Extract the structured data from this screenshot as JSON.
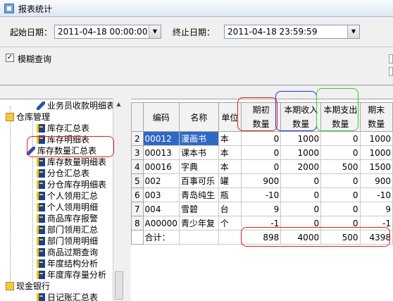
{
  "window": {
    "title": "报表统计"
  },
  "filters": {
    "start_label": "起始日期：",
    "start_value": "2011-04-18 00:00:00",
    "end_label": "终止日期：",
    "end_value": "2011-04-18 23:59:59",
    "fuzzy_label": "模糊查询",
    "fuzzy_checked": "✓"
  },
  "tree": {
    "nodes": [
      {
        "label": "业务员收款明细表",
        "icon": "pencil-book-icon"
      },
      {
        "label": "仓库管理",
        "icon": "folder-icon"
      },
      {
        "label": "库存汇总表",
        "icon": "book-icon"
      },
      {
        "label": "库存明细表",
        "icon": "book-icon"
      },
      {
        "label": "库存数量汇总表",
        "icon": "pencil-book-icon"
      },
      {
        "label": "库存数量明细表",
        "icon": "book-icon"
      },
      {
        "label": "分仓汇总表",
        "icon": "book-icon"
      },
      {
        "label": "分仓库存明细表",
        "icon": "book-icon"
      },
      {
        "label": "个人领用汇总",
        "icon": "book-icon"
      },
      {
        "label": "个人领用明细",
        "icon": "book-icon"
      },
      {
        "label": "商品库存报警",
        "icon": "book-icon"
      },
      {
        "label": "部门领用汇总",
        "icon": "book-icon"
      },
      {
        "label": "部门领用明细",
        "icon": "book-icon"
      },
      {
        "label": "商品过期查询",
        "icon": "book-icon"
      },
      {
        "label": "年度结构分析",
        "icon": "book-icon"
      },
      {
        "label": "年度库存量分析",
        "icon": "book-icon"
      },
      {
        "label": "现金银行",
        "icon": "folder-icon"
      },
      {
        "label": "日记账汇总表",
        "icon": "book-icon"
      }
    ]
  },
  "grid": {
    "headers": [
      "编码",
      "名称",
      "单位",
      "期初\n数量",
      "本期收入\n数量",
      "本期支出\n数量",
      "期末\n数量"
    ],
    "rows": [
      {
        "n": "2",
        "code": "00012",
        "name": "漫画书",
        "unit": "本",
        "open": "0",
        "in": "1000",
        "out": "0",
        "close": "1000",
        "selected": true
      },
      {
        "n": "3",
        "code": "00013",
        "name": "课本书",
        "unit": "本",
        "open": "0",
        "in": "1000",
        "out": "0",
        "close": "1000"
      },
      {
        "n": "4",
        "code": "00016",
        "name": "字典",
        "unit": "本",
        "open": "0",
        "in": "2000",
        "out": "500",
        "close": "1500"
      },
      {
        "n": "5",
        "code": "002",
        "name": "百事可乐",
        "unit": "罐",
        "open": "900",
        "in": "0",
        "out": "0",
        "close": "900"
      },
      {
        "n": "6",
        "code": "003",
        "name": "青岛纯生",
        "unit": "瓶",
        "open": "-10",
        "in": "0",
        "out": "0",
        "close": "-10"
      },
      {
        "n": "7",
        "code": "004",
        "name": "雪碧",
        "unit": "台",
        "open": "9",
        "in": "0",
        "out": "0",
        "close": "9"
      },
      {
        "n": "8",
        "code": "A00000",
        "name": "青少年复",
        "unit": "个",
        "open": "-1",
        "in": "0",
        "out": "0",
        "close": "-1"
      }
    ],
    "total_label": "合计：",
    "totals": {
      "open": "898",
      "in": "4000",
      "out": "500",
      "close": "4398"
    }
  },
  "annotation_colors": {
    "red": "#e0201c",
    "blue": "#1c2ee0",
    "green": "#2ed22e"
  }
}
